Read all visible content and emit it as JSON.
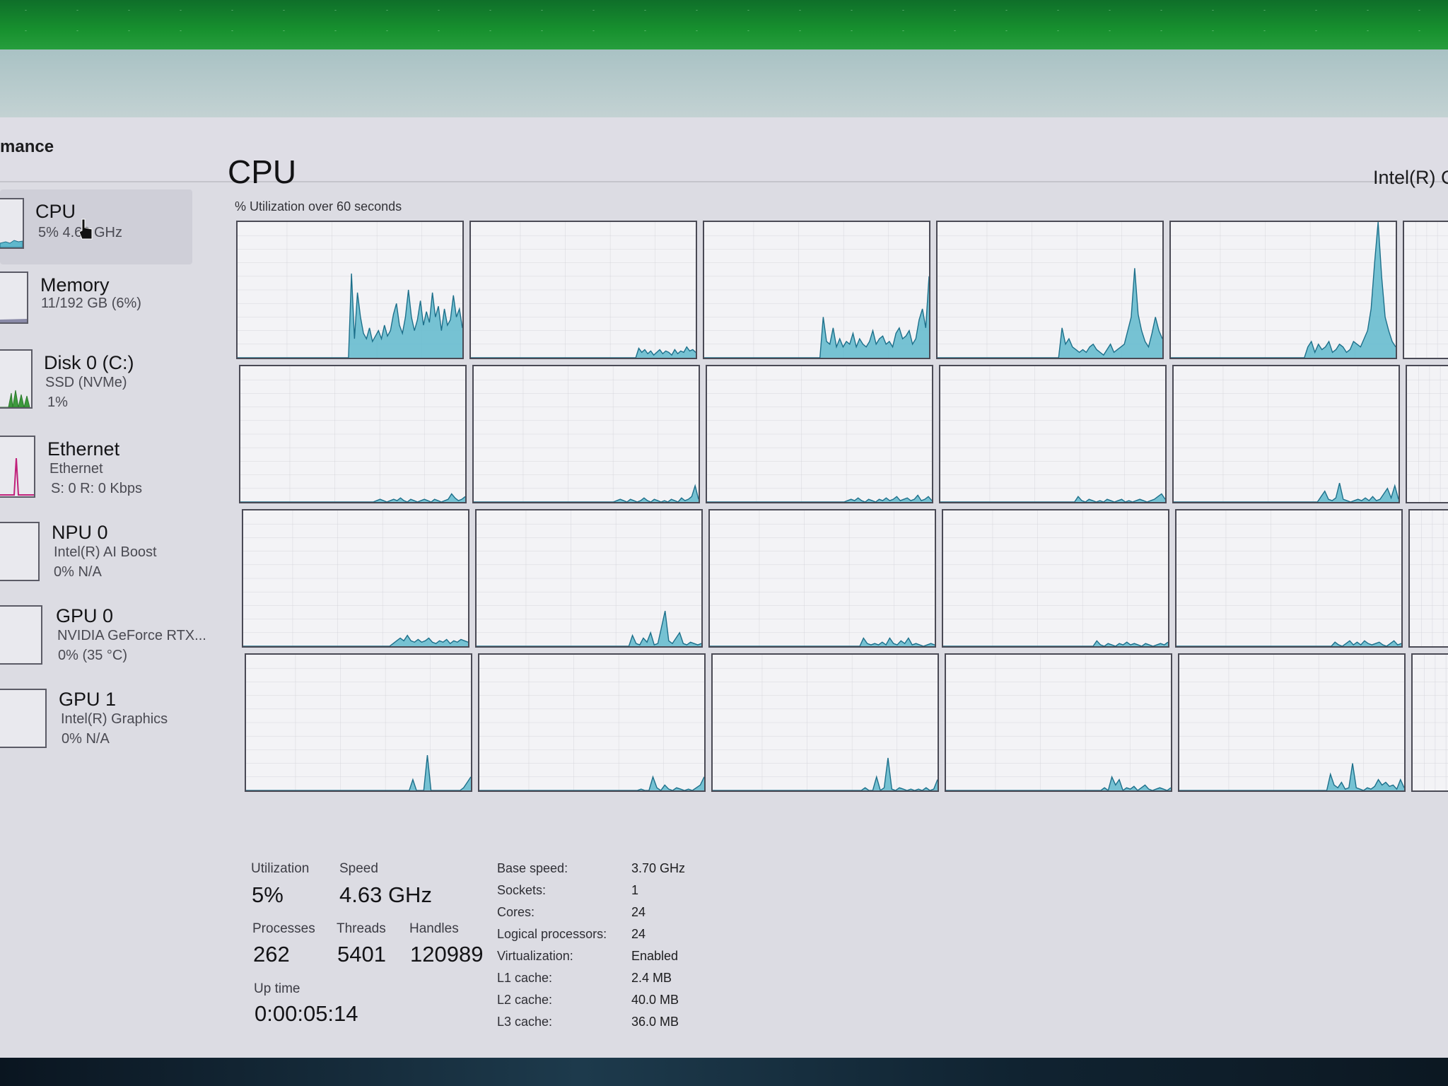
{
  "window": {
    "page_heading": "mance"
  },
  "sidebar": {
    "items": [
      {
        "title": "CPU",
        "sub1": "5% 4.63 GHz",
        "sub2": ""
      },
      {
        "title": "Memory",
        "sub1": "11/192 GB (6%)",
        "sub2": ""
      },
      {
        "title": "Disk 0 (C:)",
        "sub1": "SSD (NVMe)",
        "sub2": "1%"
      },
      {
        "title": "Ethernet",
        "sub1": "Ethernet",
        "sub2": "S: 0 R: 0 Kbps"
      },
      {
        "title": "NPU 0",
        "sub1": "Intel(R) AI Boost",
        "sub2": "0% N/A"
      },
      {
        "title": "GPU 0",
        "sub1": "NVIDIA GeForce RTX...",
        "sub2": "0% (35 °C)"
      },
      {
        "title": "GPU 1",
        "sub1": "Intel(R) Graphics",
        "sub2": "0% N/A"
      }
    ]
  },
  "main": {
    "title": "CPU",
    "cpu_model": "Intel(R) C",
    "graph_caption": "% Utilization over 60 seconds"
  },
  "stats": {
    "utilization_label": "Utilization",
    "utilization_value": "5%",
    "speed_label": "Speed",
    "speed_value": "4.63 GHz",
    "processes_label": "Processes",
    "processes_value": "262",
    "threads_label": "Threads",
    "threads_value": "5401",
    "handles_label": "Handles",
    "handles_value": "120989",
    "uptime_label": "Up time",
    "uptime_value": "0:00:05:14"
  },
  "specs": [
    {
      "label": "Base speed:",
      "value": "3.70 GHz"
    },
    {
      "label": "Sockets:",
      "value": "1"
    },
    {
      "label": "Cores:",
      "value": "24"
    },
    {
      "label": "Logical processors:",
      "value": "24"
    },
    {
      "label": "Virtualization:",
      "value": "Enabled"
    },
    {
      "label": "L1 cache:",
      "value": "2.4 MB"
    },
    {
      "label": "L2 cache:",
      "value": "40.0 MB"
    },
    {
      "label": "L3 cache:",
      "value": "36.0 MB"
    }
  ],
  "colors": {
    "graph_fill": "#5fb8cc",
    "graph_line": "#1c6f8a",
    "ethernet_line": "#c0207a",
    "disk_fill": "#3d9a3d"
  },
  "core_graphs": [
    [
      0,
      0,
      0,
      0,
      0,
      0,
      0,
      0,
      0,
      0,
      0,
      0,
      0,
      0,
      0,
      0,
      0,
      0,
      0,
      0,
      0,
      0,
      0,
      0,
      0,
      0,
      0,
      0,
      0,
      0,
      0,
      0,
      0,
      0,
      0,
      0,
      0,
      0,
      62,
      14,
      48,
      30,
      18,
      14,
      22,
      12,
      16,
      20,
      14,
      24,
      16,
      20,
      32,
      40,
      24,
      18,
      30,
      50,
      30,
      20,
      28,
      42,
      24,
      34,
      26,
      48,
      30,
      38,
      20,
      36,
      24,
      28,
      46,
      30,
      36,
      22
    ],
    [
      0,
      0,
      0,
      0,
      0,
      0,
      0,
      0,
      0,
      0,
      0,
      0,
      0,
      0,
      0,
      0,
      0,
      0,
      0,
      0,
      0,
      0,
      0,
      0,
      0,
      0,
      0,
      0,
      0,
      0,
      0,
      0,
      0,
      0,
      0,
      0,
      0,
      0,
      0,
      0,
      0,
      0,
      0,
      0,
      0,
      0,
      0,
      0,
      0,
      0,
      0,
      0,
      0,
      0,
      0,
      0,
      7,
      4,
      6,
      3,
      5,
      2,
      4,
      6,
      3,
      5,
      4,
      2,
      6,
      3,
      5,
      4,
      8,
      5,
      6,
      4
    ],
    [
      0,
      0,
      0,
      0,
      0,
      0,
      0,
      0,
      0,
      0,
      0,
      0,
      0,
      0,
      0,
      0,
      0,
      0,
      0,
      0,
      0,
      0,
      0,
      0,
      0,
      0,
      0,
      0,
      0,
      0,
      0,
      0,
      0,
      0,
      0,
      0,
      30,
      12,
      10,
      22,
      8,
      14,
      8,
      12,
      10,
      18,
      8,
      14,
      10,
      8,
      12,
      20,
      10,
      14,
      16,
      10,
      12,
      8,
      18,
      22,
      14,
      16,
      20,
      10,
      14,
      28,
      36,
      22,
      60
    ],
    [
      0,
      0,
      0,
      0,
      0,
      0,
      0,
      0,
      0,
      0,
      0,
      0,
      0,
      0,
      0,
      0,
      0,
      0,
      0,
      0,
      0,
      0,
      0,
      0,
      0,
      0,
      0,
      0,
      0,
      0,
      0,
      0,
      0,
      0,
      0,
      0,
      22,
      10,
      14,
      8,
      6,
      4,
      6,
      4,
      8,
      10,
      6,
      4,
      2,
      6,
      10,
      4,
      6,
      8,
      10,
      20,
      30,
      66,
      32,
      20,
      12,
      8,
      18,
      30,
      20,
      14
    ],
    [
      0,
      0,
      0,
      0,
      0,
      0,
      0,
      0,
      0,
      0,
      0,
      0,
      0,
      0,
      0,
      0,
      0,
      0,
      0,
      0,
      0,
      0,
      0,
      0,
      0,
      0,
      0,
      0,
      0,
      0,
      0,
      0,
      0,
      0,
      0,
      0,
      0,
      0,
      0,
      8,
      12,
      4,
      10,
      6,
      8,
      12,
      4,
      6,
      10,
      8,
      4,
      6,
      12,
      10,
      8,
      14,
      20,
      36,
      70,
      100,
      60,
      30,
      20,
      12,
      8
    ],
    [
      0,
      0,
      0,
      0,
      0,
      0,
      0,
      0,
      0,
      0,
      0,
      0,
      0,
      0,
      0,
      0,
      0,
      0,
      0,
      0,
      0,
      0,
      0,
      0,
      0,
      0,
      0,
      0,
      0,
      0,
      0,
      0,
      0,
      0,
      0,
      0,
      0,
      0,
      0,
      0,
      1,
      2,
      1,
      0,
      1,
      2,
      1,
      3,
      1,
      0,
      2,
      1,
      0,
      1,
      2,
      1,
      0,
      2,
      1,
      0,
      1,
      2,
      6,
      3,
      1,
      2,
      4
    ],
    [
      0,
      0,
      0,
      0,
      0,
      0,
      0,
      0,
      0,
      0,
      0,
      0,
      0,
      0,
      0,
      0,
      0,
      0,
      0,
      0,
      0,
      0,
      0,
      0,
      0,
      0,
      0,
      0,
      0,
      0,
      0,
      0,
      0,
      0,
      0,
      0,
      0,
      0,
      0,
      0,
      0,
      0,
      1,
      2,
      1,
      0,
      2,
      1,
      0,
      1,
      3,
      1,
      0,
      2,
      1,
      0,
      1,
      0,
      2,
      1,
      0,
      3,
      1,
      2,
      4,
      12,
      2
    ],
    [
      0,
      0,
      0,
      0,
      0,
      0,
      0,
      0,
      0,
      0,
      0,
      0,
      0,
      0,
      0,
      0,
      0,
      0,
      0,
      0,
      0,
      0,
      0,
      0,
      0,
      0,
      0,
      0,
      0,
      0,
      0,
      0,
      0,
      0,
      0,
      0,
      0,
      0,
      0,
      0,
      1,
      2,
      1,
      3,
      1,
      0,
      2,
      1,
      0,
      2,
      1,
      3,
      1,
      2,
      4,
      1,
      2,
      3,
      1,
      2,
      5,
      1,
      2,
      4,
      1
    ],
    [
      0,
      0,
      0,
      0,
      0,
      0,
      0,
      0,
      0,
      0,
      0,
      0,
      0,
      0,
      0,
      0,
      0,
      0,
      0,
      0,
      0,
      0,
      0,
      0,
      0,
      0,
      0,
      0,
      0,
      0,
      0,
      0,
      0,
      0,
      0,
      0,
      0,
      0,
      4,
      1,
      0,
      2,
      1,
      0,
      1,
      0,
      2,
      1,
      0,
      1,
      2,
      0,
      1,
      0,
      1,
      2,
      1,
      0,
      1,
      2,
      4,
      6,
      2
    ],
    [
      0,
      0,
      0,
      0,
      0,
      0,
      0,
      0,
      0,
      0,
      0,
      0,
      0,
      0,
      0,
      0,
      0,
      0,
      0,
      0,
      0,
      0,
      0,
      0,
      0,
      0,
      0,
      0,
      0,
      0,
      0,
      0,
      0,
      0,
      0,
      0,
      0,
      0,
      0,
      0,
      4,
      8,
      2,
      1,
      3,
      14,
      2,
      1,
      0,
      1,
      2,
      1,
      3,
      1,
      4,
      1,
      2,
      6,
      10,
      3,
      12,
      2
    ],
    [
      0,
      0,
      0,
      0,
      0,
      0,
      0,
      0,
      0,
      0,
      0,
      0,
      0,
      0,
      0,
      0,
      0,
      0,
      0,
      0,
      0,
      0,
      0,
      0,
      0,
      0,
      0,
      0,
      0,
      0,
      0,
      0,
      0,
      0,
      0,
      0,
      0,
      0,
      0,
      0,
      0,
      0,
      2,
      4,
      6,
      4,
      8,
      4,
      3,
      5,
      3,
      4,
      6,
      3,
      2,
      4,
      3,
      5,
      2,
      4,
      3,
      5,
      4,
      3
    ],
    [
      0,
      0,
      0,
      0,
      0,
      0,
      0,
      0,
      0,
      0,
      0,
      0,
      0,
      0,
      0,
      0,
      0,
      0,
      0,
      0,
      0,
      0,
      0,
      0,
      0,
      0,
      0,
      0,
      0,
      0,
      0,
      0,
      0,
      0,
      0,
      0,
      0,
      0,
      0,
      0,
      0,
      0,
      0,
      8,
      2,
      1,
      6,
      3,
      10,
      1,
      2,
      14,
      26,
      4,
      2,
      6,
      10,
      2,
      1,
      3,
      2,
      1,
      2
    ],
    [
      0,
      0,
      0,
      0,
      0,
      0,
      0,
      0,
      0,
      0,
      0,
      0,
      0,
      0,
      0,
      0,
      0,
      0,
      0,
      0,
      0,
      0,
      0,
      0,
      0,
      0,
      0,
      0,
      0,
      0,
      0,
      0,
      0,
      0,
      0,
      0,
      0,
      0,
      0,
      0,
      0,
      6,
      2,
      1,
      2,
      1,
      3,
      1,
      6,
      2,
      1,
      4,
      2,
      6,
      1,
      2,
      1,
      0,
      1,
      2,
      1
    ],
    [
      0,
      0,
      0,
      0,
      0,
      0,
      0,
      0,
      0,
      0,
      0,
      0,
      0,
      0,
      0,
      0,
      0,
      0,
      0,
      0,
      0,
      0,
      0,
      0,
      0,
      0,
      0,
      0,
      0,
      0,
      0,
      0,
      0,
      0,
      0,
      0,
      0,
      0,
      0,
      0,
      0,
      4,
      1,
      0,
      2,
      1,
      0,
      2,
      1,
      3,
      1,
      2,
      1,
      0,
      2,
      1,
      0,
      1,
      2,
      1,
      3
    ],
    [
      0,
      0,
      0,
      0,
      0,
      0,
      0,
      0,
      0,
      0,
      0,
      0,
      0,
      0,
      0,
      0,
      0,
      0,
      0,
      0,
      0,
      0,
      0,
      0,
      0,
      0,
      0,
      0,
      0,
      0,
      0,
      0,
      0,
      0,
      0,
      0,
      0,
      0,
      0,
      0,
      0,
      0,
      0,
      3,
      1,
      0,
      2,
      4,
      1,
      3,
      1,
      4,
      2,
      1,
      2,
      3,
      1,
      0,
      2,
      4,
      1,
      2
    ],
    [
      0,
      0,
      0,
      0,
      0,
      0,
      0,
      0,
      0,
      0,
      0,
      0,
      0,
      0,
      0,
      0,
      0,
      0,
      0,
      0,
      0,
      0,
      0,
      0,
      0,
      0,
      0,
      0,
      0,
      0,
      0,
      0,
      0,
      0,
      0,
      0,
      0,
      0,
      0,
      0,
      0,
      0,
      0,
      0,
      0,
      0,
      8,
      0,
      0,
      0,
      26,
      0,
      0,
      0,
      0,
      0,
      0,
      0,
      0,
      0,
      2,
      6,
      10
    ],
    [
      0,
      0,
      0,
      0,
      0,
      0,
      0,
      0,
      0,
      0,
      0,
      0,
      0,
      0,
      0,
      0,
      0,
      0,
      0,
      0,
      0,
      0,
      0,
      0,
      0,
      0,
      0,
      0,
      0,
      0,
      0,
      0,
      0,
      0,
      0,
      0,
      0,
      0,
      0,
      0,
      0,
      1,
      0,
      0,
      10,
      2,
      0,
      4,
      1,
      0,
      2,
      1,
      0,
      1,
      0,
      2,
      4,
      10
    ],
    [
      0,
      0,
      0,
      0,
      0,
      0,
      0,
      0,
      0,
      0,
      0,
      0,
      0,
      0,
      0,
      0,
      0,
      0,
      0,
      0,
      0,
      0,
      0,
      0,
      0,
      0,
      0,
      0,
      0,
      0,
      0,
      0,
      0,
      0,
      0,
      0,
      0,
      0,
      0,
      0,
      2,
      0,
      0,
      10,
      0,
      2,
      24,
      1,
      0,
      2,
      1,
      0,
      1,
      0,
      1,
      0,
      2,
      0,
      1,
      8
    ],
    [
      0,
      0,
      0,
      0,
      0,
      0,
      0,
      0,
      0,
      0,
      0,
      0,
      0,
      0,
      0,
      0,
      0,
      0,
      0,
      0,
      0,
      0,
      0,
      0,
      0,
      0,
      0,
      0,
      0,
      0,
      0,
      0,
      0,
      0,
      0,
      0,
      0,
      0,
      0,
      0,
      0,
      0,
      0,
      2,
      0,
      10,
      4,
      8,
      0,
      2,
      1,
      3,
      0,
      2,
      4,
      1,
      0,
      1,
      2,
      1,
      0,
      2
    ],
    [
      0,
      0,
      0,
      0,
      0,
      0,
      0,
      0,
      0,
      0,
      0,
      0,
      0,
      0,
      0,
      0,
      0,
      0,
      0,
      0,
      0,
      0,
      0,
      0,
      0,
      0,
      0,
      0,
      0,
      0,
      0,
      0,
      0,
      0,
      0,
      0,
      0,
      0,
      0,
      0,
      0,
      12,
      4,
      2,
      6,
      1,
      2,
      20,
      2,
      1,
      0,
      2,
      1,
      3,
      8,
      4,
      6,
      3,
      4,
      1,
      8,
      2
    ]
  ]
}
